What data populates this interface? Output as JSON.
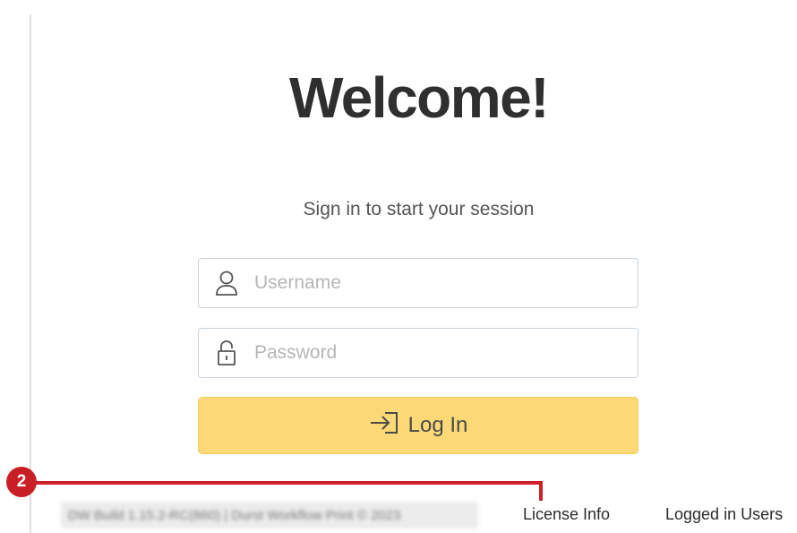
{
  "welcome": {
    "title": "Welcome!",
    "subtitle": "Sign in to start your session"
  },
  "form": {
    "username": {
      "placeholder": "Username",
      "value": "",
      "icon": "user-icon"
    },
    "password": {
      "placeholder": "Password",
      "value": "",
      "icon": "lock-icon"
    },
    "login_label": "Log In",
    "login_icon": "sign-in-icon"
  },
  "annotation": {
    "badge": "2",
    "color": "#c81f26"
  },
  "footer": {
    "build_info": "DW Build 1.15.2-RC(860) | Durst Workflow Print © 2023",
    "license_link": "License Info",
    "users_link": "Logged in Users"
  },
  "colors": {
    "accent": "#fcd976",
    "annotation": "#c81f26",
    "field_border": "#c9d3dc"
  }
}
